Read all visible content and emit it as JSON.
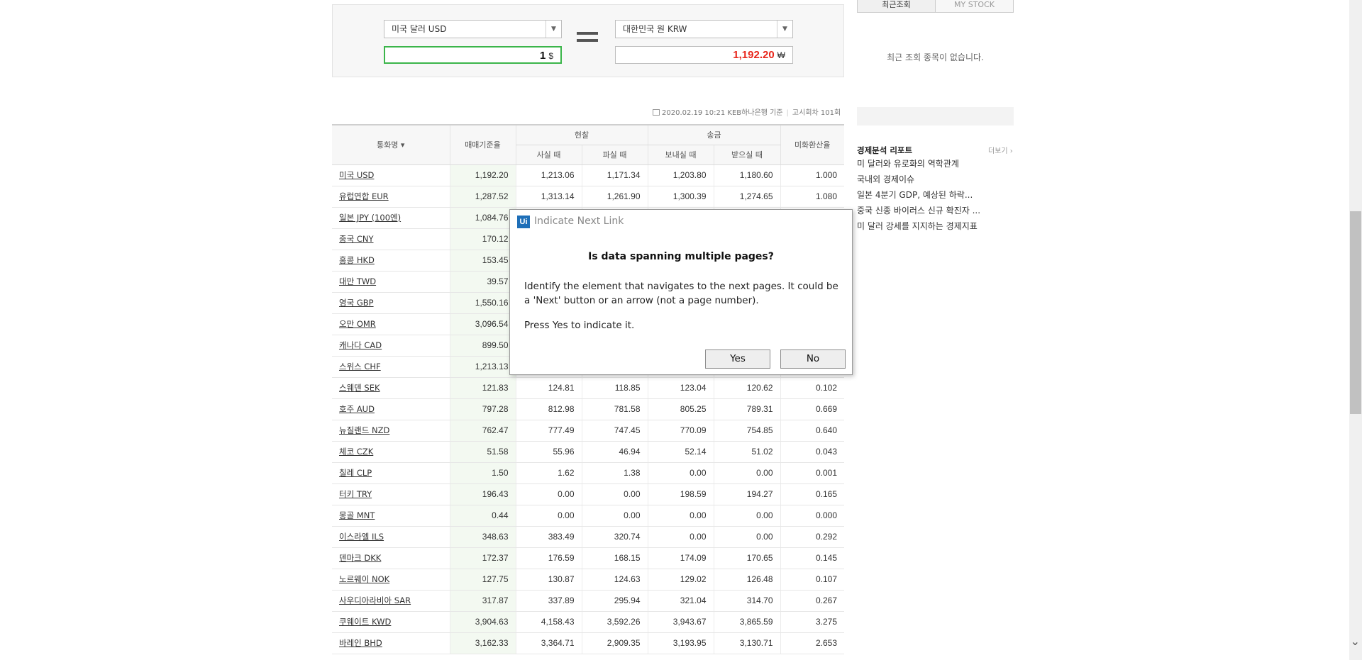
{
  "converter": {
    "from_currency": "미국 달러 USD",
    "to_currency": "대한민국 원 KRW",
    "from_amount": "1",
    "from_unit": "$",
    "to_amount": "1,192.20",
    "to_unit": "₩",
    "colors": {
      "from_border": "#3bb54a",
      "to_amount": "#e8261b"
    }
  },
  "meta": {
    "date_source": "2020.02.19 10:21 KEB하나은행 기준",
    "notice_count": "고시회차 101회"
  },
  "table": {
    "headers": {
      "currency": "통화명",
      "base_rate": "매매기준율",
      "cash": "현찰",
      "transfer": "송금",
      "usd_rate": "미화환산율",
      "cash_buy": "사실 때",
      "cash_sell": "파실 때",
      "send": "보내실 때",
      "receive": "받으실 때"
    },
    "rows": [
      {
        "name": "미국 USD",
        "base": "1,192.20",
        "cash_buy": "1,213.06",
        "cash_sell": "1,171.34",
        "send": "1,203.80",
        "receive": "1,180.60",
        "usd": "1.000"
      },
      {
        "name": "유럽연합 EUR",
        "base": "1,287.52",
        "cash_buy": "1,313.14",
        "cash_sell": "1,261.90",
        "send": "1,300.39",
        "receive": "1,274.65",
        "usd": "1.080"
      },
      {
        "name": "일본 JPY (100엔)",
        "base": "1,084.76",
        "cash_buy": "",
        "cash_sell": "",
        "send": "",
        "receive": "",
        "usd": ""
      },
      {
        "name": "중국 CNY",
        "base": "170.12",
        "cash_buy": "",
        "cash_sell": "",
        "send": "",
        "receive": "",
        "usd": ""
      },
      {
        "name": "홍콩 HKD",
        "base": "153.45",
        "cash_buy": "",
        "cash_sell": "",
        "send": "",
        "receive": "",
        "usd": ""
      },
      {
        "name": "대만 TWD",
        "base": "39.57",
        "cash_buy": "",
        "cash_sell": "",
        "send": "",
        "receive": "",
        "usd": ""
      },
      {
        "name": "영국 GBP",
        "base": "1,550.16",
        "cash_buy": "",
        "cash_sell": "",
        "send": "",
        "receive": "",
        "usd": ""
      },
      {
        "name": "오만 OMR",
        "base": "3,096.54",
        "cash_buy": "",
        "cash_sell": "",
        "send": "",
        "receive": "",
        "usd": ""
      },
      {
        "name": "캐나다 CAD",
        "base": "899.50",
        "cash_buy": "",
        "cash_sell": "",
        "send": "",
        "receive": "",
        "usd": ""
      },
      {
        "name": "스위스 CHF",
        "base": "1,213.13",
        "cash_buy": "",
        "cash_sell": "",
        "send": "",
        "receive": "",
        "usd": ""
      },
      {
        "name": "스웨덴 SEK",
        "base": "121.83",
        "cash_buy": "124.81",
        "cash_sell": "118.85",
        "send": "123.04",
        "receive": "120.62",
        "usd": "0.102"
      },
      {
        "name": "호주 AUD",
        "base": "797.28",
        "cash_buy": "812.98",
        "cash_sell": "781.58",
        "send": "805.25",
        "receive": "789.31",
        "usd": "0.669"
      },
      {
        "name": "뉴질랜드 NZD",
        "base": "762.47",
        "cash_buy": "777.49",
        "cash_sell": "747.45",
        "send": "770.09",
        "receive": "754.85",
        "usd": "0.640"
      },
      {
        "name": "체코 CZK",
        "base": "51.58",
        "cash_buy": "55.96",
        "cash_sell": "46.94",
        "send": "52.14",
        "receive": "51.02",
        "usd": "0.043"
      },
      {
        "name": "칠레 CLP",
        "base": "1.50",
        "cash_buy": "1.62",
        "cash_sell": "1.38",
        "send": "0.00",
        "receive": "0.00",
        "usd": "0.001"
      },
      {
        "name": "터키 TRY",
        "base": "196.43",
        "cash_buy": "0.00",
        "cash_sell": "0.00",
        "send": "198.59",
        "receive": "194.27",
        "usd": "0.165"
      },
      {
        "name": "몽골 MNT",
        "base": "0.44",
        "cash_buy": "0.00",
        "cash_sell": "0.00",
        "send": "0.00",
        "receive": "0.00",
        "usd": "0.000"
      },
      {
        "name": "이스라엘 ILS",
        "base": "348.63",
        "cash_buy": "383.49",
        "cash_sell": "320.74",
        "send": "0.00",
        "receive": "0.00",
        "usd": "0.292"
      },
      {
        "name": "덴마크 DKK",
        "base": "172.37",
        "cash_buy": "176.59",
        "cash_sell": "168.15",
        "send": "174.09",
        "receive": "170.65",
        "usd": "0.145"
      },
      {
        "name": "노르웨이 NOK",
        "base": "127.75",
        "cash_buy": "130.87",
        "cash_sell": "124.63",
        "send": "129.02",
        "receive": "126.48",
        "usd": "0.107"
      },
      {
        "name": "사우디아라비아 SAR",
        "base": "317.87",
        "cash_buy": "337.89",
        "cash_sell": "295.94",
        "send": "321.04",
        "receive": "314.70",
        "usd": "0.267"
      },
      {
        "name": "쿠웨이트 KWD",
        "base": "3,904.63",
        "cash_buy": "4,158.43",
        "cash_sell": "3,592.26",
        "send": "3,943.67",
        "receive": "3,865.59",
        "usd": "3.275"
      },
      {
        "name": "바레인 BHD",
        "base": "3,162.33",
        "cash_buy": "3,364.71",
        "cash_sell": "2,909.35",
        "send": "3,193.95",
        "receive": "3,130.71",
        "usd": "2.653"
      }
    ]
  },
  "sidebar": {
    "tab_recent": "최근조회",
    "tab_stock": "MY STOCK",
    "empty_message": "최근 조회 종목이 없습니다.",
    "report_title": "경제분석 리포트",
    "report_more": "더보기",
    "reports": [
      "미 달러와 유로화의 역학관계",
      "국내외 경제이슈",
      "일본 4분기 GDP, 예상된 하락...",
      "중국 신종 바이러스 신규 확진자 ...",
      "미 달러 강세를 지지하는 경제지표"
    ]
  },
  "dialog": {
    "app_icon": "Ui",
    "title": "Indicate Next Link",
    "heading": "Is data spanning multiple pages?",
    "body": "Identify the element that navigates to the next pages. It could be a 'Next' button or an arrow (not a page number).",
    "press": "Press Yes to indicate it.",
    "yes_label": "Yes",
    "no_label": "No"
  }
}
